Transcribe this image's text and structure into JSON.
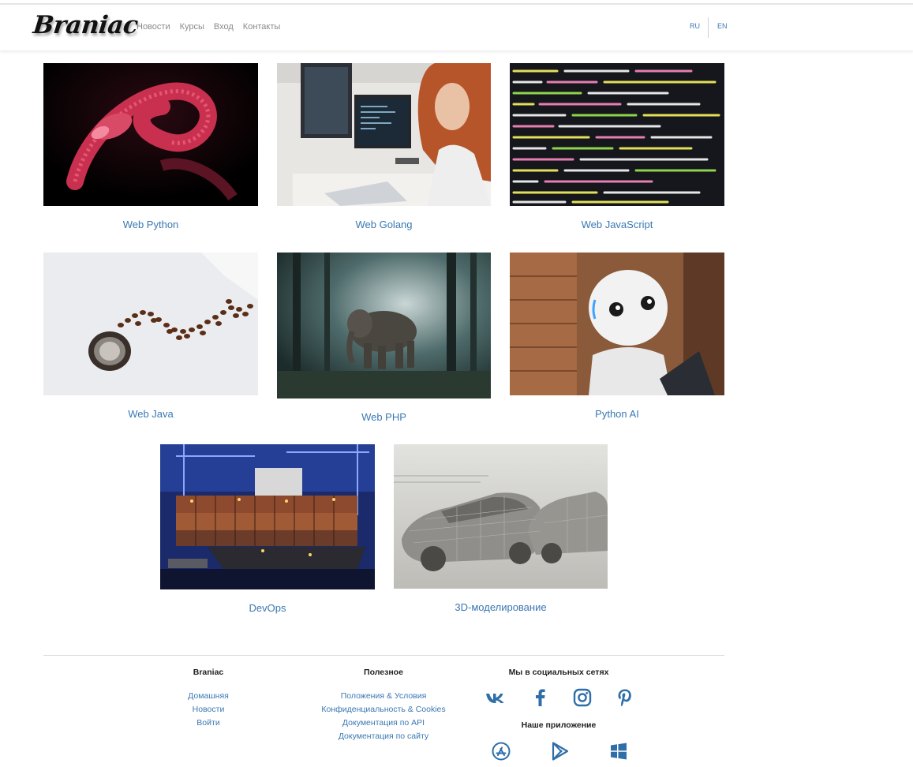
{
  "brand": {
    "logo": "Braniac"
  },
  "nav": {
    "links": [
      "Новости",
      "Курсы",
      "Вход",
      "Контакты"
    ],
    "lang": [
      "RU",
      "EN"
    ]
  },
  "courses": [
    {
      "title": "Web Python",
      "image": "python-snake"
    },
    {
      "title": "Web Golang",
      "image": "office-woman-computer"
    },
    {
      "title": "Web JavaScript",
      "image": "code-screen"
    },
    {
      "title": "Web Java",
      "image": "coffee-beans-cup"
    },
    {
      "title": "Web PHP",
      "image": "elephant-forest"
    },
    {
      "title": "Python AI",
      "image": "robot"
    },
    {
      "title": "DevOps",
      "image": "container-ship"
    },
    {
      "title": "3D-моделирование",
      "image": "wireframe-cars"
    }
  ],
  "footer": {
    "col1": {
      "heading": "Braniac",
      "links": [
        "Домашняя",
        "Новости",
        "Войти"
      ]
    },
    "col2": {
      "heading": "Полезное",
      "links": [
        "Положения & Условия",
        "Конфиденциальность & Cookies",
        "Документация по API",
        "Документация по сайту"
      ]
    },
    "col3": {
      "heading": "Мы в социальных сетях",
      "social": [
        "vk-icon",
        "facebook-icon",
        "instagram-icon",
        "pinterest-icon"
      ],
      "apps_heading": "Наше приложение",
      "apps": [
        "app-store-icon",
        "google-play-icon",
        "windows-icon"
      ]
    }
  },
  "colors": {
    "link": "#3a78b3",
    "icon": "#2f6ea8"
  }
}
